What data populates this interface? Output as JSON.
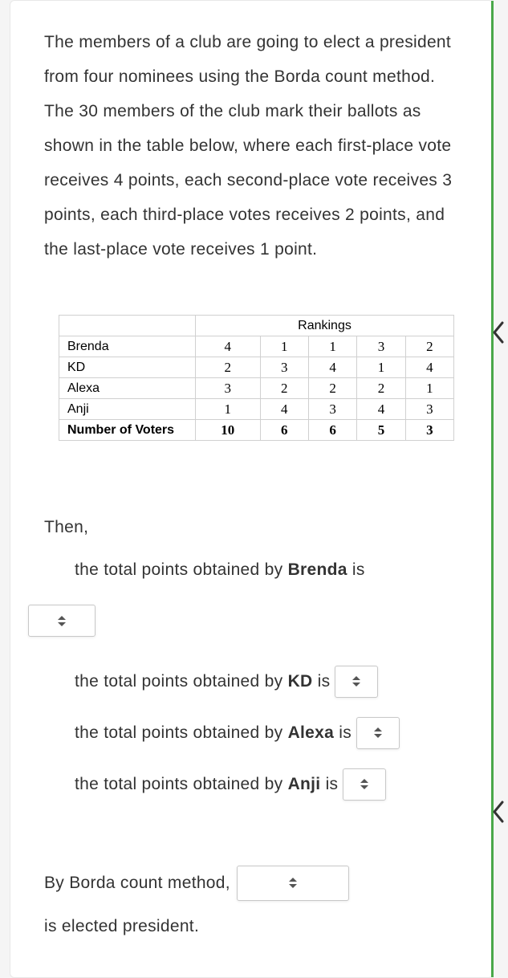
{
  "intro": "The members of a club are going to elect a president from four nominees using the Borda count method. The 30 members of the club mark their ballots as shown in the table below, where each first-place vote receives 4 points, each second-place vote receives 3 points, each third-place votes receives 2 points, and the last-place vote receives 1 point.",
  "table": {
    "header_span": "Rankings",
    "rows": [
      {
        "label": "Brenda",
        "cells": [
          "4",
          "1",
          "1",
          "3",
          "2"
        ],
        "bold": false
      },
      {
        "label": "KD",
        "cells": [
          "2",
          "3",
          "4",
          "1",
          "4"
        ],
        "bold": false
      },
      {
        "label": "Alexa",
        "cells": [
          "3",
          "2",
          "2",
          "2",
          "1"
        ],
        "bold": false
      },
      {
        "label": "Anji",
        "cells": [
          "1",
          "4",
          "3",
          "4",
          "3"
        ],
        "bold": false
      },
      {
        "label": "Number of Voters",
        "cells": [
          "10",
          "6",
          "6",
          "5",
          "3"
        ],
        "bold": true
      }
    ]
  },
  "then_label": "Then,",
  "lines": {
    "brenda_pre": "the total points obtained by ",
    "brenda_name": "Brenda",
    "brenda_post": " is",
    "kd_pre": "the total points obtained by ",
    "kd_name": "KD",
    "kd_post": " is",
    "alexa_pre": "the total points obtained by ",
    "alexa_name": "Alexa",
    "alexa_post": " is",
    "anji_pre": "the total points obtained by ",
    "anji_name": "Anji",
    "anji_post": " is"
  },
  "final": {
    "pre": "By Borda count method,",
    "post": "is elected president."
  }
}
